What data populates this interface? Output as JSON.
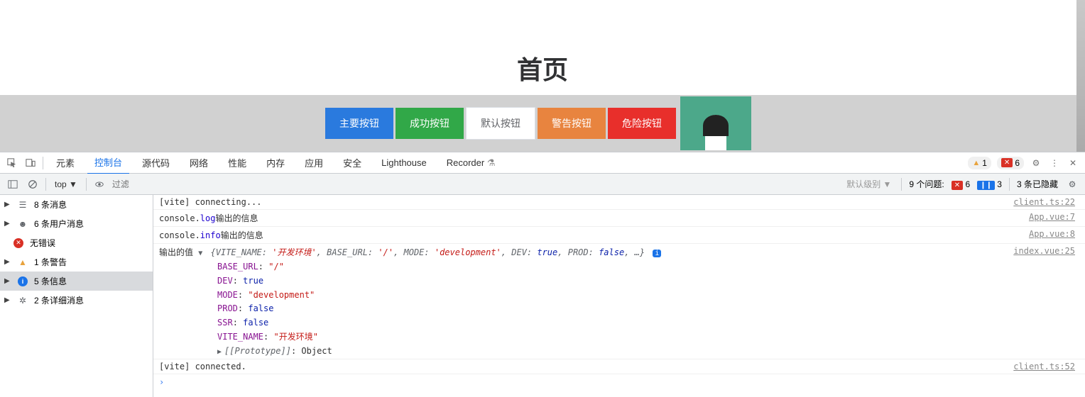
{
  "page": {
    "title": "首页",
    "buttons": {
      "primary": "主要按钮",
      "success": "成功按钮",
      "default": "默认按钮",
      "warning": "警告按钮",
      "danger": "危险按钮"
    }
  },
  "devtools": {
    "tabs": {
      "elements": "元素",
      "console": "控制台",
      "sources": "源代码",
      "network": "网络",
      "performance": "性能",
      "memory": "内存",
      "application": "应用",
      "security": "安全",
      "lighthouse": "Lighthouse",
      "recorder": "Recorder"
    },
    "warn_count": "1",
    "error_count": "6",
    "toolbar": {
      "top": "top ▼",
      "filter_placeholder": "过滤",
      "level": "默认级别 ▼",
      "issues_label": "9 个问题:",
      "issue_err": "6",
      "issue_info": "3",
      "hidden": "3 条已隐藏"
    },
    "sidebar": {
      "messages": "8 条消息",
      "user": "6 条用户消息",
      "errors": "无错误",
      "warnings": "1 条警告",
      "info": "5 条信息",
      "verbose": "2 条详细消息"
    },
    "logs": {
      "l1": {
        "text": "[vite] connecting...",
        "src": "client.ts:22"
      },
      "l2": {
        "prefix": "console.",
        "method": "log",
        "text": "输出的信息",
        "src": "App.vue:7"
      },
      "l3": {
        "prefix": "console.",
        "method": "info",
        "text": "输出的信息",
        "src": "App.vue:8"
      },
      "l4": {
        "label": "输出的值",
        "preview": "{VITE_NAME: '开发环境', BASE_URL: '/', MODE: 'development', DEV: true, PROD: false, …}",
        "src": "index.vue:25",
        "expanded": {
          "BASE_URL": "\"/\"",
          "DEV": "true",
          "MODE": "\"development\"",
          "PROD": "false",
          "SSR": "false",
          "VITE_NAME": "\"开发环境\"",
          "proto_label": "[[Prototype]]",
          "proto_val": ": Object"
        }
      },
      "l5": {
        "text": "[vite] connected.",
        "src": "client.ts:52"
      },
      "prompt": "›"
    }
  }
}
